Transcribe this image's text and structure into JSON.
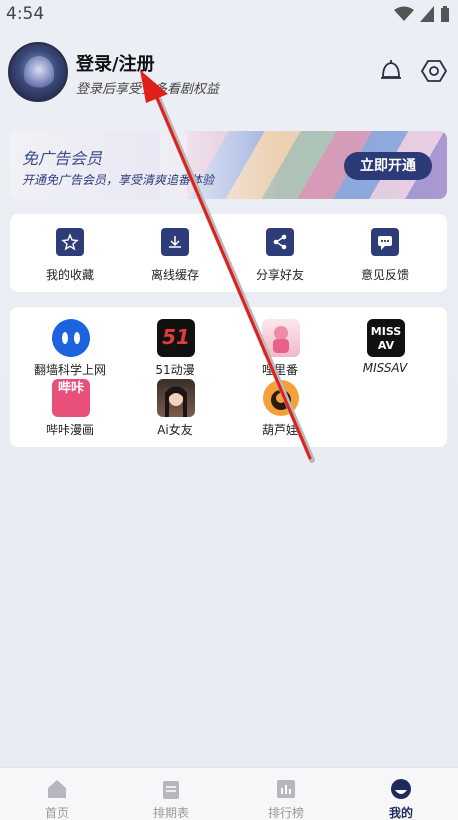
{
  "status_bar": {
    "time": "4:54"
  },
  "profile": {
    "title": "登录/注册",
    "subtitle": "登录后享受更多看剧权益"
  },
  "vip_banner": {
    "title": "免广告会员",
    "subtitle": "开通免广告会员，享受清爽追番体验",
    "button_label": "立即开通"
  },
  "quick_actions": [
    {
      "label": "我的收藏",
      "icon": "star-icon"
    },
    {
      "label": "离线缓存",
      "icon": "download-icon"
    },
    {
      "label": "分享好友",
      "icon": "share-icon"
    },
    {
      "label": "意见反馈",
      "icon": "feedback-icon"
    }
  ],
  "apps": [
    {
      "label": "翻墙科学上网"
    },
    {
      "label": "51动漫",
      "icon_text": "51"
    },
    {
      "label": "哩里番"
    },
    {
      "label": "MISSAV",
      "icon_text": "MISS AV"
    },
    {
      "label": "哔咔漫画",
      "icon_text": "哔咔"
    },
    {
      "label": "Ai女友"
    },
    {
      "label": "葫芦娃"
    }
  ],
  "bottom_nav": [
    {
      "label": "首页",
      "icon": "home-icon",
      "active": false
    },
    {
      "label": "排期表",
      "icon": "schedule-icon",
      "active": false
    },
    {
      "label": "排行榜",
      "icon": "ranking-icon",
      "active": false
    },
    {
      "label": "我的",
      "icon": "profile-icon",
      "active": true
    }
  ],
  "colors": {
    "accent": "#2e3d79",
    "arrow": "#e0201a"
  }
}
